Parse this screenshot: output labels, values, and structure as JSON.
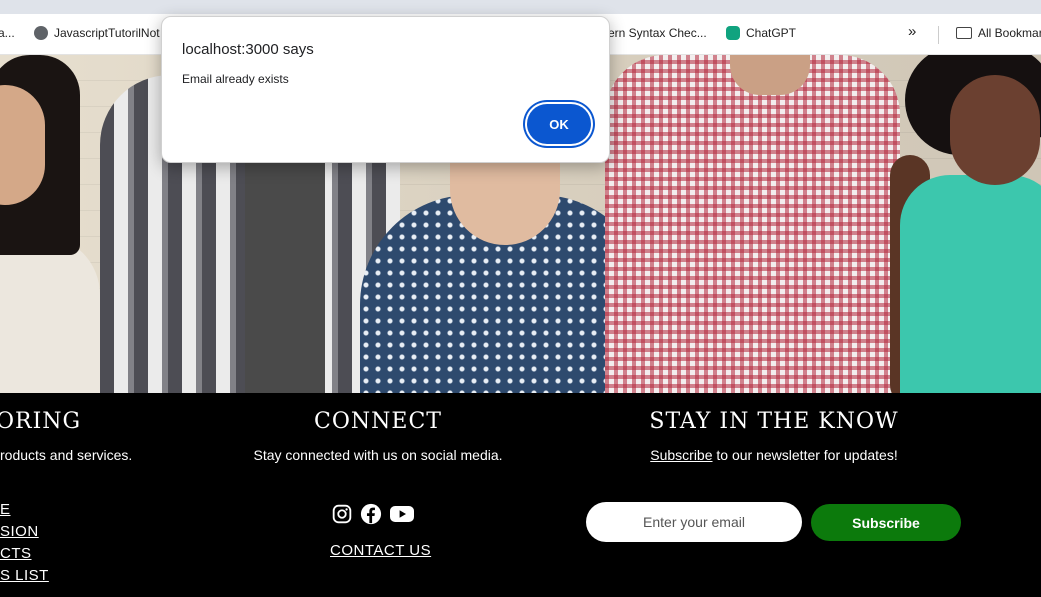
{
  "bookmarks": {
    "items": [
      {
        "label": "a...",
        "icon": "globe-icon"
      },
      {
        "label": "JavascriptTutorilNot",
        "icon": "globe-icon"
      },
      {
        "label": "ern Syntax Chec...",
        "icon": ""
      },
      {
        "label": "ChatGPT",
        "icon": "chatgpt-icon"
      }
    ],
    "overflow": "»",
    "all_bookmarks": "All Bookmar"
  },
  "dialog": {
    "title": "localhost:3000 says",
    "message": "Email already exists",
    "ok_label": "OK"
  },
  "footer": {
    "exploring": {
      "title": "ORING",
      "text": "roducts and services.",
      "links": [
        "E",
        "SION",
        "CTS",
        "S LIST"
      ]
    },
    "connect": {
      "title": "CONNECT",
      "text": "Stay connected with us on social media.",
      "social_icons": [
        "instagram-icon",
        "facebook-icon",
        "youtube-icon"
      ],
      "contact_link": "CONTACT US"
    },
    "newsletter": {
      "title": "STAY IN THE KNOW",
      "subscribe_word": "Subscribe",
      "text_rest": " to our newsletter for updates!",
      "email_placeholder": "Enter your email",
      "subscribe_button": "Subscribe"
    }
  },
  "colors": {
    "dialog_button": "#0b57d0",
    "subscribe_button": "#0c7a0c",
    "footer_bg": "#000000"
  }
}
